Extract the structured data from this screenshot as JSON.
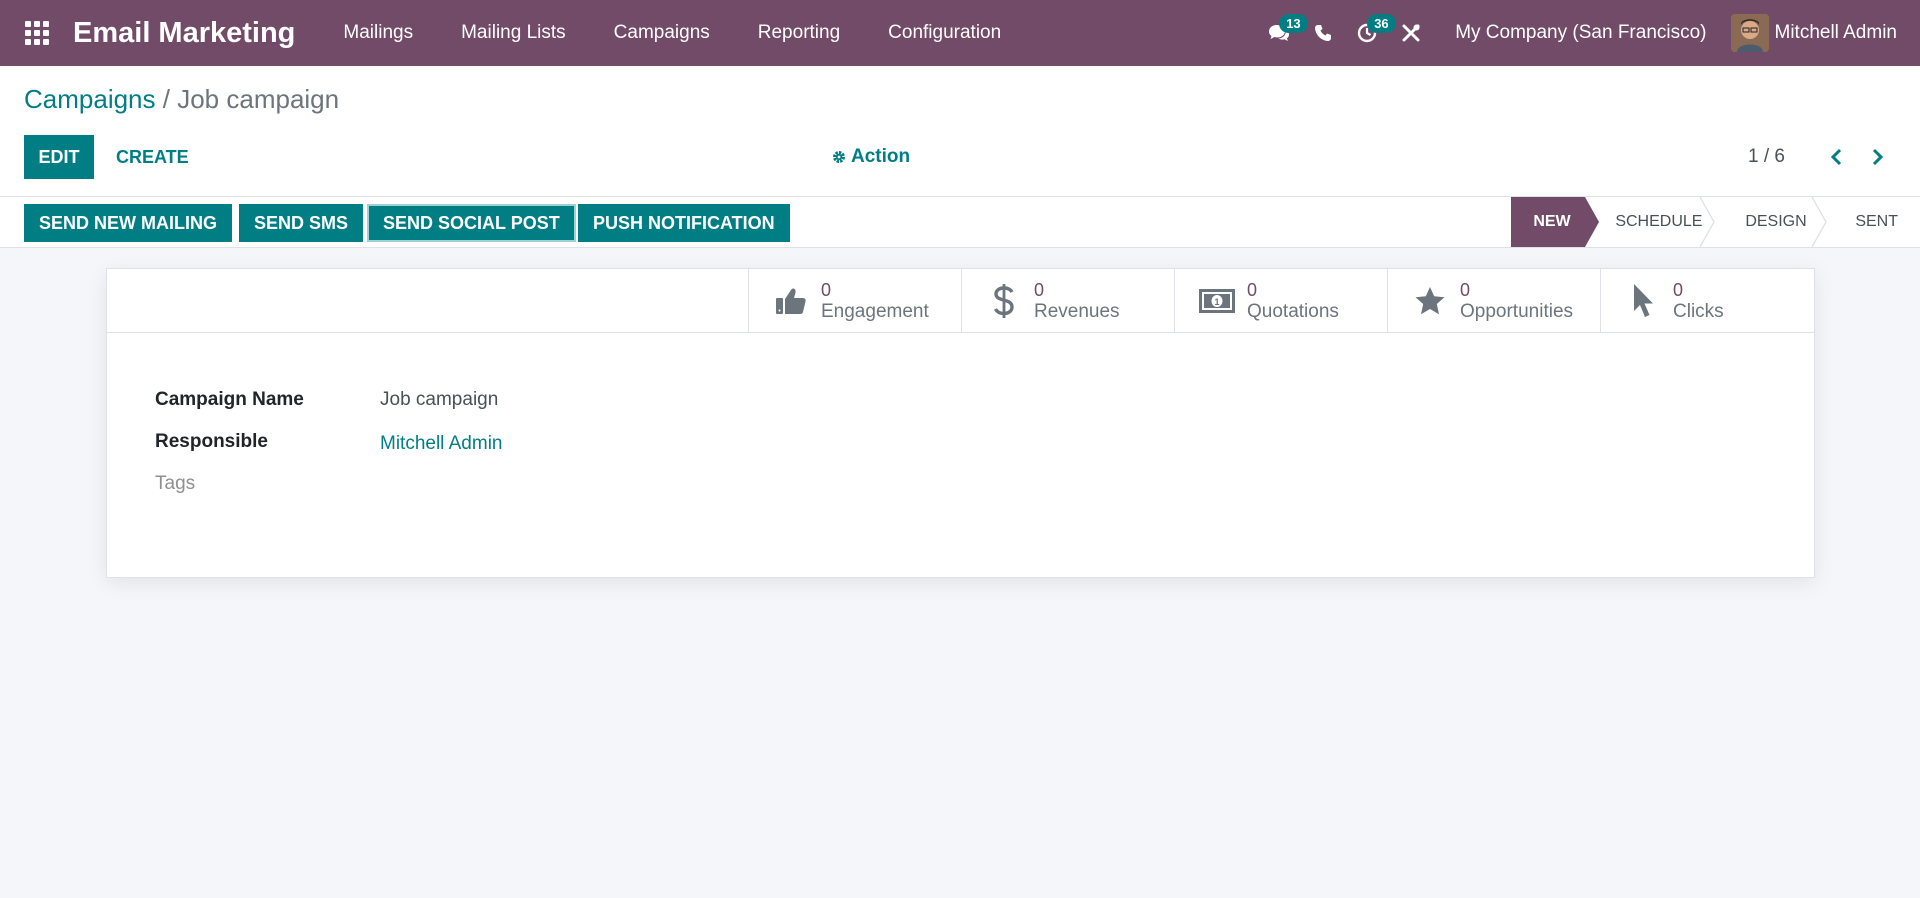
{
  "navbar": {
    "brand": "Email Marketing",
    "menu": [
      "Mailings",
      "Mailing Lists",
      "Campaigns",
      "Reporting",
      "Configuration"
    ],
    "messages_count": "13",
    "activities_count": "36",
    "company": "My Company (San Francisco)",
    "user": "Mitchell Admin",
    "icons": [
      "apps-grid-icon",
      "chat-icon",
      "phone-icon",
      "clock-icon",
      "tools-icon"
    ]
  },
  "breadcrumb": {
    "parent": "Campaigns",
    "separator": "/",
    "current": "Job campaign"
  },
  "control": {
    "edit_label": "EDIT",
    "create_label": "CREATE",
    "action_label": "Action",
    "pager": "1 / 6"
  },
  "statusbar": {
    "buttons": [
      "SEND NEW MAILING",
      "SEND SMS",
      "SEND SOCIAL POST",
      "PUSH NOTIFICATION"
    ],
    "stages": [
      "NEW",
      "SCHEDULE",
      "DESIGN",
      "SENT"
    ],
    "active_stage": "NEW"
  },
  "smart_buttons": [
    {
      "value": "0",
      "label": "Engagement",
      "icon": "thumbs-up-icon"
    },
    {
      "value": "0",
      "label": "Revenues",
      "icon": "dollar-icon"
    },
    {
      "value": "0",
      "label": "Quotations",
      "icon": "money-bill-icon"
    },
    {
      "value": "0",
      "label": "Opportunities",
      "icon": "star-icon"
    },
    {
      "value": "0",
      "label": "Clicks",
      "icon": "cursor-icon"
    }
  ],
  "form": {
    "campaign_name_label": "Campaign Name",
    "campaign_name_value": "Job campaign",
    "responsible_label": "Responsible",
    "responsible_value": "Mitchell Admin",
    "tags_label": "Tags"
  },
  "colors": {
    "brand": "#714b67",
    "accent": "#017e84",
    "background": "#f5f6f9"
  }
}
